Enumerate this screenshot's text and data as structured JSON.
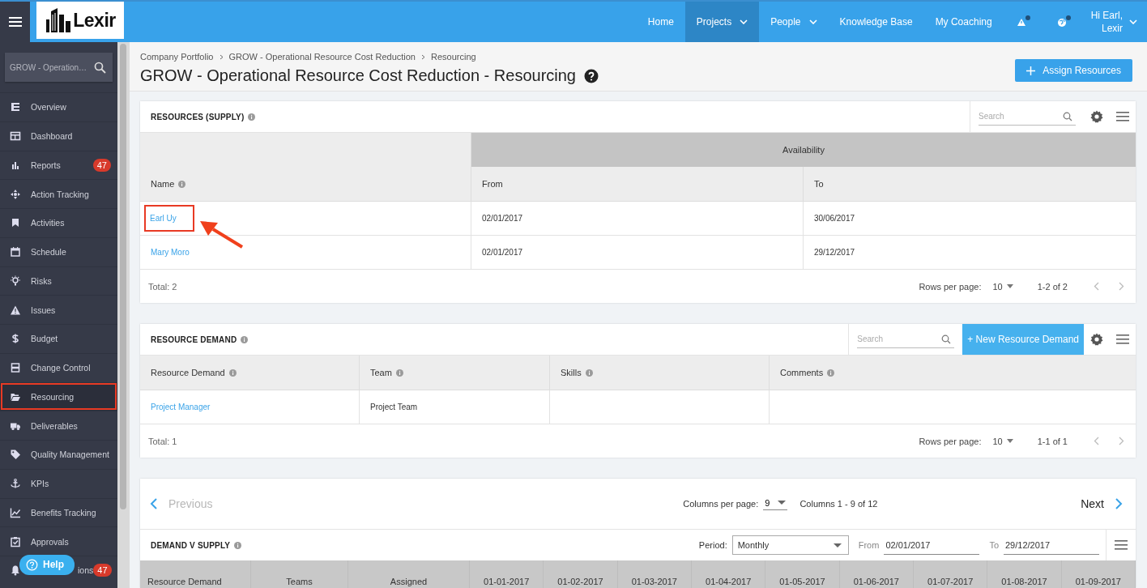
{
  "topbar": {
    "logo": "Lexir",
    "nav": [
      {
        "label": "Home",
        "selected": false,
        "dropdown": false
      },
      {
        "label": "Projects",
        "selected": true,
        "dropdown": true
      },
      {
        "label": "People",
        "selected": false,
        "dropdown": true
      },
      {
        "label": "Knowledge Base",
        "selected": false,
        "dropdown": false
      },
      {
        "label": "My Coaching",
        "selected": false,
        "dropdown": false
      }
    ],
    "greeting": [
      "Hi Earl,",
      "Lexir"
    ]
  },
  "sidebar": {
    "search_value": "GROW - Operation…",
    "items": [
      {
        "label": "Overview",
        "selected": false
      },
      {
        "label": "Dashboard",
        "selected": false
      },
      {
        "label": "Reports",
        "selected": false,
        "badge": "47"
      },
      {
        "label": "Action Tracking",
        "selected": false
      },
      {
        "label": "Activities",
        "selected": false
      },
      {
        "label": "Schedule",
        "selected": false
      },
      {
        "label": "Risks",
        "selected": false
      },
      {
        "label": "Issues",
        "selected": false
      },
      {
        "label": "Budget",
        "selected": false
      },
      {
        "label": "Change Control",
        "selected": false
      },
      {
        "label": "Resourcing",
        "selected": true
      },
      {
        "label": "Deliverables",
        "selected": false
      },
      {
        "label": "Quality Management",
        "selected": false
      },
      {
        "label": "KPIs",
        "selected": false
      },
      {
        "label": "Benefits Tracking",
        "selected": false
      },
      {
        "label": "Approvals",
        "selected": false
      },
      {
        "label": "ions",
        "selected": false,
        "badge": "47"
      }
    ],
    "help": "Help"
  },
  "breadcrumb": [
    "Company Portfolio",
    "GROW - Operational Resource Cost Reduction",
    "Resourcing"
  ],
  "title": "GROW - Operational Resource Cost Reduction - Resourcing",
  "assign_button": "Assign Resources",
  "supply": {
    "title": "RESOURCES (SUPPLY)",
    "search_placeholder": "Search",
    "group_header": "Availability",
    "columns": [
      {
        "label": "Name",
        "info": true
      },
      {
        "label": "From",
        "info": false
      },
      {
        "label": "To",
        "info": false
      }
    ],
    "rows": [
      {
        "name": "Earl Uy",
        "from": "02/01/2017",
        "to": "30/06/2017",
        "highlighted": true
      },
      {
        "name": "Mary Moro",
        "from": "02/01/2017",
        "to": "29/12/2017",
        "highlighted": false
      }
    ],
    "total": "Total: 2",
    "rows_per_page_label": "Rows per page:",
    "rows_per_page": "10",
    "range": "1-2 of 2"
  },
  "demand": {
    "title": "RESOURCE DEMAND",
    "search_placeholder": "Search",
    "new_button": "+ New Resource Demand",
    "columns": [
      {
        "label": "Resource Demand",
        "info": true
      },
      {
        "label": "Team",
        "info": true
      },
      {
        "label": "Skills",
        "info": true
      },
      {
        "label": "Comments",
        "info": true
      }
    ],
    "rows": [
      [
        "Project Manager",
        "Project Team",
        "",
        ""
      ]
    ],
    "total": "Total: 1",
    "rows_per_page_label": "Rows per page:",
    "rows_per_page": "10",
    "range": "1-1 of 1"
  },
  "demand_v_supply": {
    "previous": "Previous",
    "previous_disabled": true,
    "next": "Next",
    "columns_per_page_label": "Columns per page:",
    "columns_per_page": "9",
    "columns_range": "Columns 1 - 9 of 12",
    "title": "DEMAND V SUPPLY",
    "period_label": "Period:",
    "period": "Monthly",
    "from_label": "From",
    "from": "02/01/2017",
    "to_label": "To",
    "to": "29/12/2017",
    "columns": [
      "Resource Demand",
      "Teams",
      "Assigned",
      "01-01-2017",
      "01-02-2017",
      "01-03-2017",
      "01-04-2017",
      "01-05-2017",
      "01-06-2017",
      "01-07-2017",
      "01-08-2017",
      "01-09-2017"
    ]
  }
}
